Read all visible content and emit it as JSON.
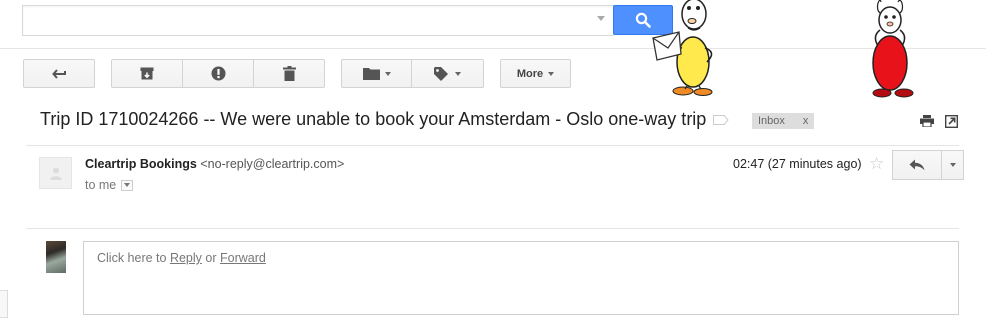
{
  "search": {
    "placeholder": "",
    "value": ""
  },
  "toolbar": {
    "back_icon": "back-arrow-icon",
    "archive_icon": "archive-icon",
    "spam_icon": "report-spam-icon",
    "delete_icon": "trash-icon",
    "move_icon": "folder-icon",
    "labels_icon": "label-tag-icon",
    "more_label": "More"
  },
  "email": {
    "subject": "Trip ID 1710024266 -- We were unable to book your Amsterdam - Oslo one-way trip",
    "label_chip": "Inbox",
    "label_chip_remove": "x",
    "sender_name": "Cleartrip Bookings",
    "sender_email": "<no-reply@cleartrip.com>",
    "to_line": "to me",
    "timestamp": "02:47 (27 minutes ago)",
    "star": "☆"
  },
  "reply": {
    "prefix": "Click here to ",
    "reply_link": "Reply",
    "middle": " or ",
    "forward_link": "Forward"
  },
  "colors": {
    "search_button": "#4d90fe",
    "subject_text": "#222222",
    "chip_bg": "#dddddd",
    "cartoon_yellow": "#ffe94d",
    "cartoon_red": "#e8121b"
  }
}
